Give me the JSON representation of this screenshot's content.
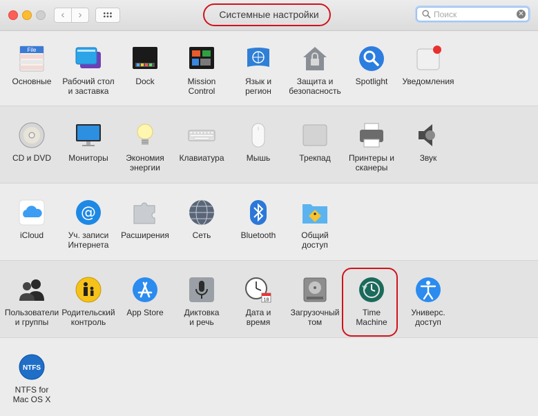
{
  "window": {
    "title": "Системные настройки"
  },
  "search": {
    "placeholder": "Поиск"
  },
  "rows": [
    {
      "items": [
        {
          "name": "osnovnye",
          "label": "Основные"
        },
        {
          "name": "desktop",
          "label": "Рабочий стол\nи заставка"
        },
        {
          "name": "dock",
          "label": "Dock"
        },
        {
          "name": "mission-control",
          "label": "Mission\nControl"
        },
        {
          "name": "language",
          "label": "Язык и\nрегион"
        },
        {
          "name": "security",
          "label": "Защита и\nбезопасность"
        },
        {
          "name": "spotlight",
          "label": "Spotlight"
        },
        {
          "name": "notifications",
          "label": "Уведомления"
        }
      ]
    },
    {
      "items": [
        {
          "name": "cd-dvd",
          "label": "CD и DVD"
        },
        {
          "name": "monitors",
          "label": "Мониторы"
        },
        {
          "name": "energy",
          "label": "Экономия\nэнергии"
        },
        {
          "name": "keyboard",
          "label": "Клавиатура"
        },
        {
          "name": "mouse",
          "label": "Мышь"
        },
        {
          "name": "trackpad",
          "label": "Трекпад"
        },
        {
          "name": "printers",
          "label": "Принтеры и\nсканеры"
        },
        {
          "name": "sound",
          "label": "Звук"
        }
      ]
    },
    {
      "items": [
        {
          "name": "icloud",
          "label": "iCloud"
        },
        {
          "name": "internet-accounts",
          "label": "Уч. записи\nИнтернета"
        },
        {
          "name": "extensions",
          "label": "Расширения"
        },
        {
          "name": "network",
          "label": "Сеть"
        },
        {
          "name": "bluetooth",
          "label": "Bluetooth"
        },
        {
          "name": "sharing",
          "label": "Общий\nдоступ"
        }
      ]
    },
    {
      "items": [
        {
          "name": "users",
          "label": "Пользователи\nи группы"
        },
        {
          "name": "parental",
          "label": "Родительский\nконтроль"
        },
        {
          "name": "app-store",
          "label": "App Store"
        },
        {
          "name": "dictation",
          "label": "Диктовка\nи речь"
        },
        {
          "name": "date-time",
          "label": "Дата и\nвремя"
        },
        {
          "name": "startup-disk",
          "label": "Загрузочный\nтом"
        },
        {
          "name": "time-machine",
          "label": "Time\nMachine"
        },
        {
          "name": "accessibility",
          "label": "Универс.\nдоступ"
        }
      ]
    },
    {
      "items": [
        {
          "name": "ntfs",
          "label": "NTFS for\nMac OS X"
        }
      ]
    }
  ],
  "icon_text": {
    "file_doc": "File",
    "ntfs_badge": "NTFS",
    "calendar_day": "18"
  },
  "colors": {
    "highlight": "#d0121b",
    "accent": "#1d8fe6"
  }
}
